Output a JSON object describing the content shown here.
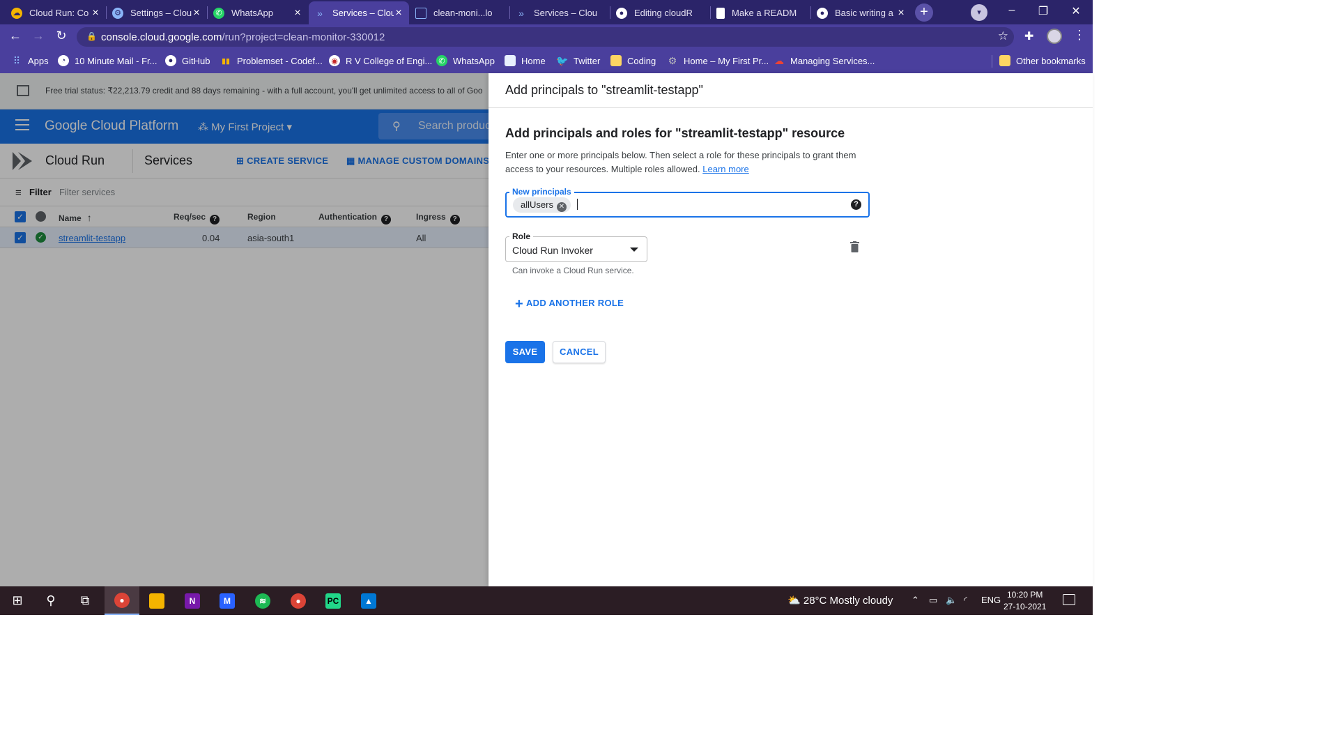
{
  "browser": {
    "tabs": [
      {
        "title": "Cloud Run: Co",
        "icon": "cloud-icon",
        "color": "#f4b400"
      },
      {
        "title": "Settings – Clou",
        "icon": "settings-icon",
        "color": "#8ab4f8"
      },
      {
        "title": "WhatsApp",
        "icon": "whatsapp-icon",
        "color": "#25d366"
      },
      {
        "title": "Services – Clou",
        "icon": "cloud-run-icon",
        "color": "#8ab4f8"
      },
      {
        "title": "clean-moni...lo",
        "icon": "doc-icon",
        "color": "#8ab4f8"
      },
      {
        "title": "Services – Clou",
        "icon": "cloud-run-icon",
        "color": "#8ab4f8"
      },
      {
        "title": "Editing cloudR",
        "icon": "github-icon",
        "color": "#ffffff"
      },
      {
        "title": "Make a READM",
        "icon": "file-icon",
        "color": "#ffffff"
      },
      {
        "title": "Basic writing a",
        "icon": "github-icon",
        "color": "#ffffff"
      }
    ],
    "url_host": "console.cloud.google.com",
    "url_path": "/run?project=clean-monitor-330012",
    "bookmarks": [
      {
        "label": "Apps",
        "icon": "apps-grid-icon"
      },
      {
        "label": "10 Minute Mail - Fr...",
        "icon": "mail-icon"
      },
      {
        "label": "GitHub",
        "icon": "github-icon"
      },
      {
        "label": "Problemset - Codef...",
        "icon": "bar-chart-icon"
      },
      {
        "label": "R V College of Engi...",
        "icon": "college-icon"
      },
      {
        "label": "WhatsApp",
        "icon": "whatsapp-icon"
      },
      {
        "label": "Home",
        "icon": "page-icon"
      },
      {
        "label": "Twitter",
        "icon": "twitter-icon"
      },
      {
        "label": "Coding",
        "icon": "folder-icon"
      },
      {
        "label": "Home – My First Pr...",
        "icon": "gear-icon"
      },
      {
        "label": "Managing Services...",
        "icon": "cloud-icon"
      }
    ],
    "other_bookmarks": "Other bookmarks"
  },
  "gcp": {
    "trial_status": "Free trial status: ₹22,213.79 credit and 88 days remaining - with a full account, you'll get unlimited access to all of Goo",
    "platform_title": "Google Cloud Platform",
    "project": "My First Project",
    "search_placeholder": "Search products",
    "product": "Cloud Run",
    "page": "Services",
    "create_service": "CREATE SERVICE",
    "manage_domains": "MANAGE CUSTOM DOMAINS",
    "filter_label": "Filter",
    "filter_placeholder": "Filter services",
    "columns": {
      "name": "Name",
      "req": "Req/sec",
      "region": "Region",
      "auth": "Authentication",
      "ingress": "Ingress"
    },
    "row": {
      "name": "streamlit-testapp",
      "req": "0.04",
      "region": "asia-south1",
      "auth": "",
      "ingress": "All"
    }
  },
  "dialog": {
    "title": "Add principals to \"streamlit-testapp\"",
    "section_title": "Add principals and roles for \"streamlit-testapp\" resource",
    "description": "Enter one or more principals below. Then select a role for these principals to grant them access to your resources. Multiple roles allowed.",
    "learn_more": "Learn more",
    "principals_label": "New principals",
    "principal_chip": "allUsers",
    "role_label": "Role",
    "role_value": "Cloud Run Invoker",
    "role_hint": "Can invoke a Cloud Run service.",
    "add_role": "ADD ANOTHER ROLE",
    "save": "SAVE",
    "cancel": "CANCEL"
  },
  "taskbar": {
    "weather": "28°C  Mostly cloudy",
    "lang": "ENG",
    "time": "10:20 PM",
    "date": "27-10-2021"
  },
  "colors": {
    "accent": "#1a73e8",
    "browser_frame": "#4a3f9d"
  }
}
